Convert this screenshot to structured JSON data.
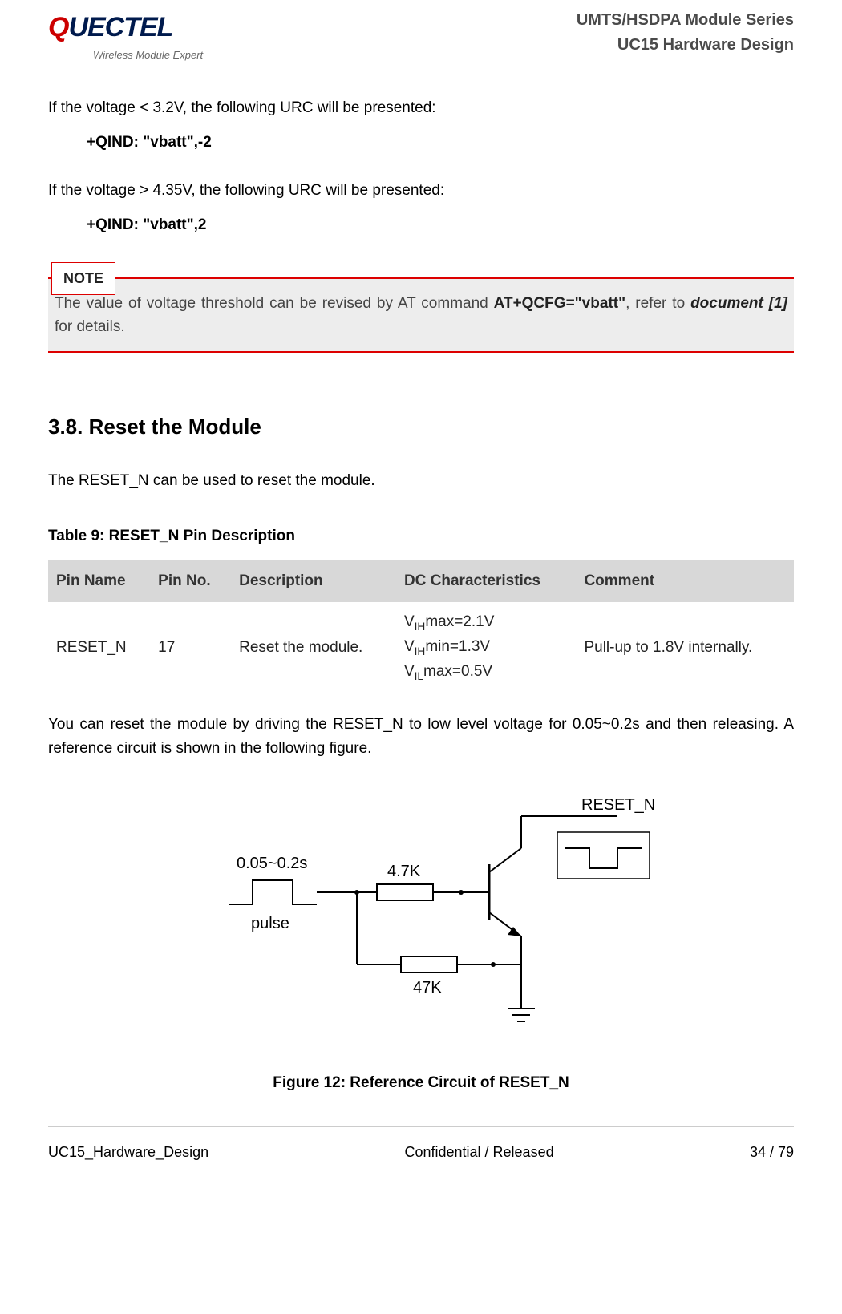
{
  "logo": {
    "brand_q": "Q",
    "brand_rest": "UECTEL",
    "tagline": "Wireless Module Expert"
  },
  "header": {
    "line1": "UMTS/HSDPA Module Series",
    "line2": "UC15 Hardware Design"
  },
  "body": {
    "p1": "If the voltage < 3.2V, the following URC will be presented:",
    "urc1": "+QIND: \"vbatt\",-2",
    "p2": "If the voltage > 4.35V, the following URC will be presented:",
    "urc2": "+QIND: \"vbatt\",2"
  },
  "note": {
    "label": "NOTE",
    "pre": "The value of voltage threshold can be revised by AT command ",
    "cmd": "AT+QCFG=\"vbatt\"",
    "mid": ", refer to ",
    "doc": "document [1]",
    "post": " for details."
  },
  "section": {
    "num_title": "3.8. Reset the Module",
    "intro": "The RESET_N can be used to reset the module."
  },
  "table": {
    "caption": "Table 9: RESET_N Pin Description",
    "headers": {
      "c1": "Pin Name",
      "c2": "Pin No.",
      "c3": "Description",
      "c4": "DC Characteristics",
      "c5": "Comment"
    },
    "row": {
      "pin_name": "RESET_N",
      "pin_no": "17",
      "desc": "Reset the module.",
      "dc1_pre": "V",
      "dc1_sub": "IH",
      "dc1_post": "max=2.1V",
      "dc2_pre": "V",
      "dc2_sub": "IH",
      "dc2_post": "min=1.3V",
      "dc3_pre": "V",
      "dc3_sub": "IL",
      "dc3_post": "max=0.5V",
      "comment": "Pull-up to 1.8V internally."
    }
  },
  "after_table": "You can reset the module by driving the RESET_N to low level voltage for 0.05~0.2s and then releasing. A reference circuit is shown in the following figure.",
  "figure": {
    "pulse_time": "0.05~0.2s",
    "pulse_label": "pulse",
    "r1": "4.7K",
    "r2": "47K",
    "signal": "RESET_N",
    "caption": "Figure 12: Reference Circuit of RESET_N"
  },
  "footer": {
    "left": "UC15_Hardware_Design",
    "center": "Confidential / Released",
    "right": "34 / 79"
  }
}
